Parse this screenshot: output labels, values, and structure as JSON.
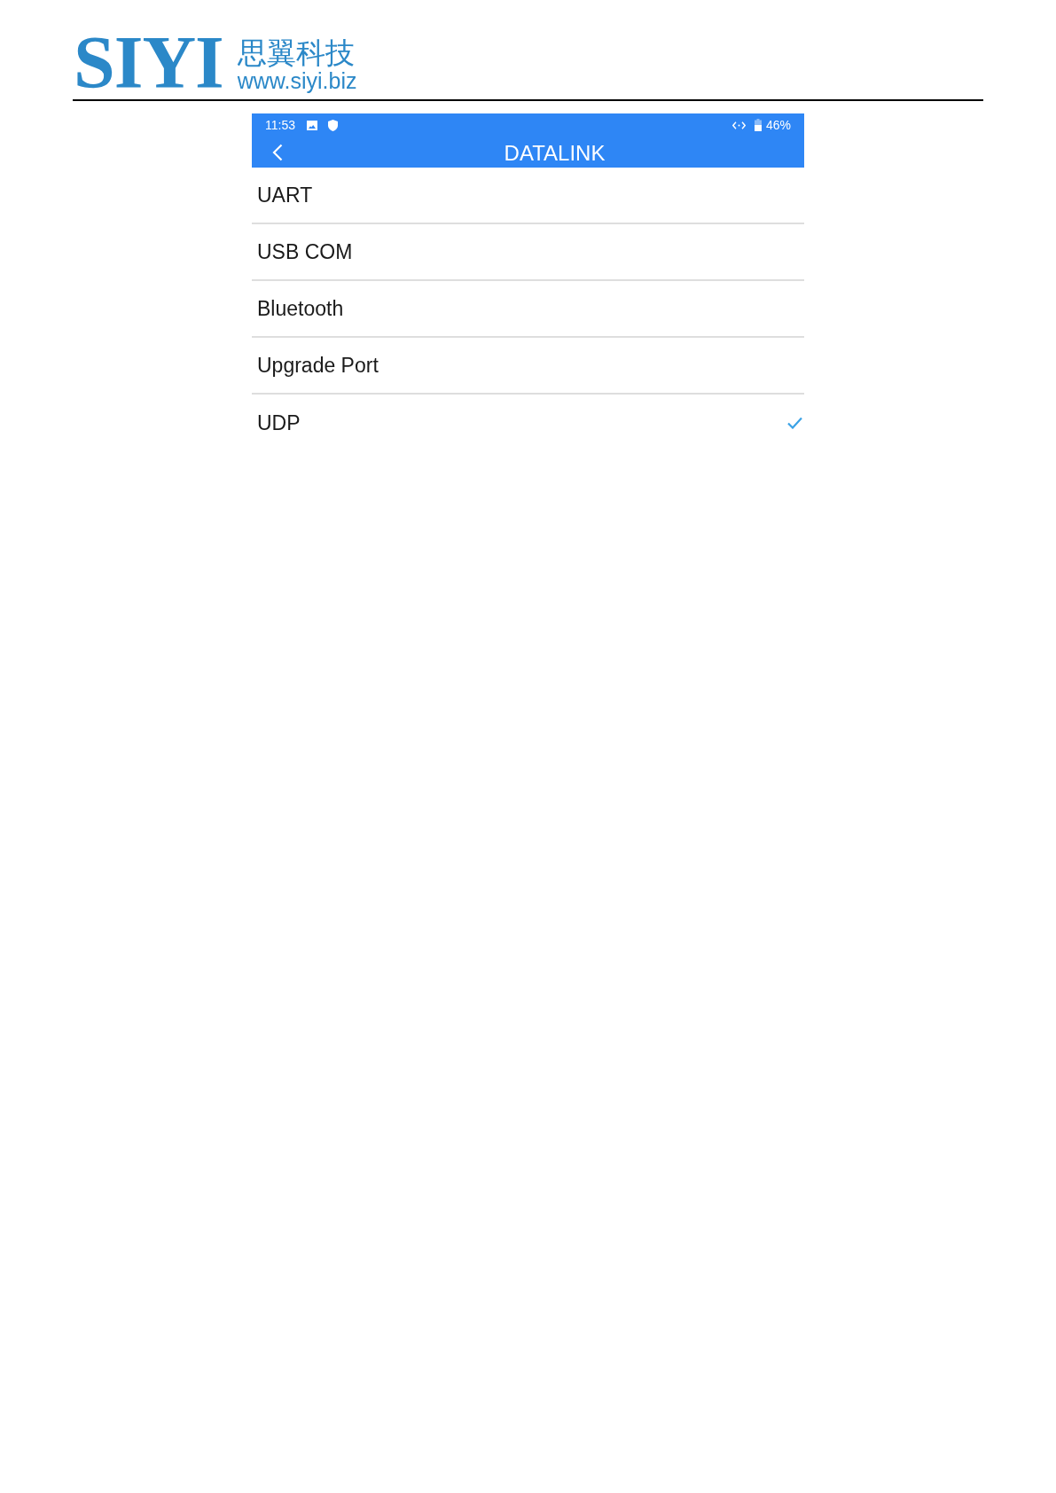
{
  "header": {
    "logo": "SIYI",
    "company_name": "思翼科技",
    "website": "www.siyi.biz"
  },
  "status_bar": {
    "time": "11:53",
    "battery": "46%"
  },
  "app_bar": {
    "title": "DATALINK"
  },
  "items": [
    {
      "label": "UART",
      "selected": false
    },
    {
      "label": "USB COM",
      "selected": false
    },
    {
      "label": "Bluetooth",
      "selected": false
    },
    {
      "label": "Upgrade Port",
      "selected": false
    },
    {
      "label": "UDP",
      "selected": true
    }
  ]
}
